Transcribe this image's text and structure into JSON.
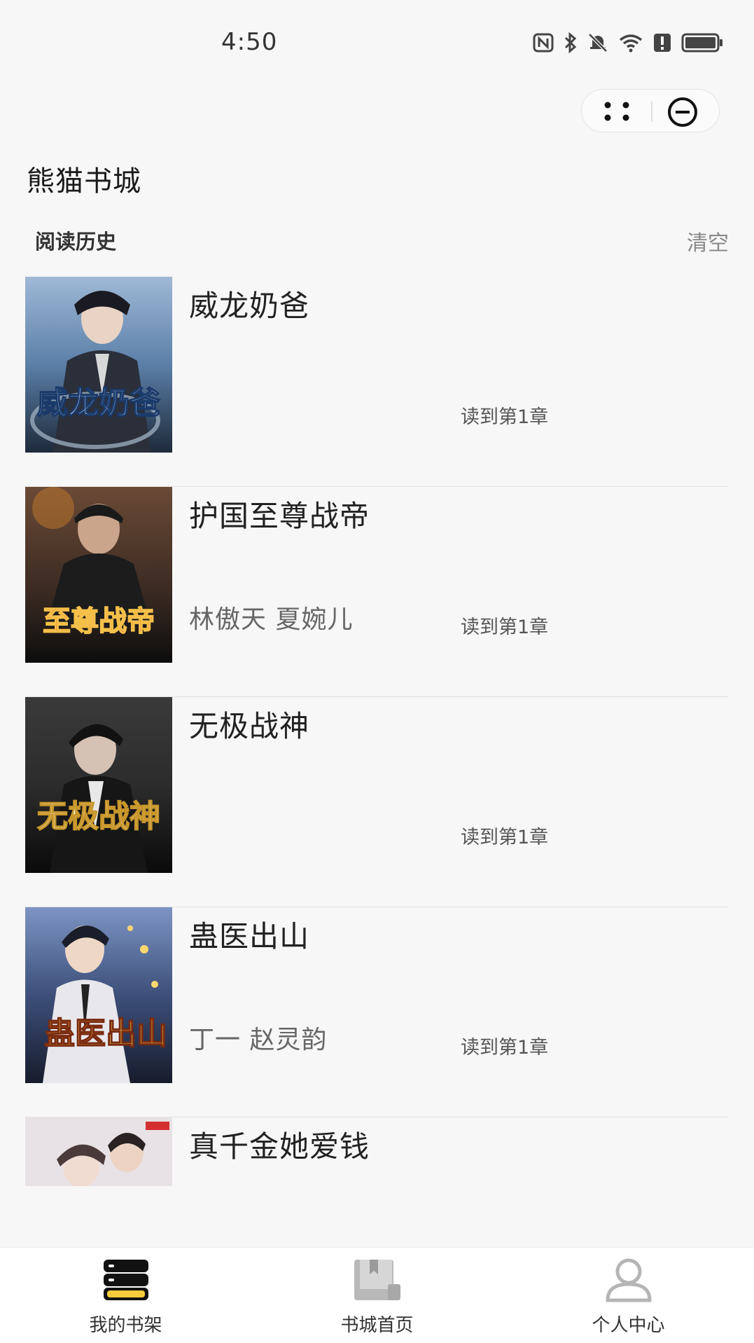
{
  "status_bar": {
    "time": "4:50",
    "icons": [
      "nfc-icon",
      "bluetooth-icon",
      "mute-icon",
      "wifi-icon",
      "alert-icon",
      "battery-icon"
    ]
  },
  "capsule": {
    "more_icon": "more-dots-icon",
    "close_icon": "minus-circle-icon"
  },
  "app_title": "熊猫书城",
  "history": {
    "title": "阅读历史",
    "clear_label": "清空"
  },
  "books": [
    {
      "title": "威龙奶爸",
      "author": "",
      "progress": "读到第1章",
      "cover_text": "威龙奶爸",
      "cover_colors": [
        "#5b7fa8",
        "#1e2a3a"
      ]
    },
    {
      "title": "护国至尊战帝",
      "author": "林傲天 夏婉儿",
      "progress": "读到第1章",
      "cover_text": "至尊战帝",
      "cover_colors": [
        "#3a2a22",
        "#0d0d0d"
      ]
    },
    {
      "title": "无极战神",
      "author": "",
      "progress": "读到第1章",
      "cover_text": "无极战神",
      "cover_colors": [
        "#2c2c2c",
        "#0a0a0a"
      ]
    },
    {
      "title": "蛊医出山",
      "author": "丁一 赵灵韵",
      "progress": "读到第1章",
      "cover_text": "蛊医出山",
      "cover_colors": [
        "#3d4f7a",
        "#171c2c"
      ]
    },
    {
      "title": "真千金她爱钱",
      "author": "",
      "progress": "",
      "cover_text": "",
      "cover_colors": [
        "#e8e2e6",
        "#c9c3c9"
      ]
    }
  ],
  "tabs": [
    {
      "label": "我的书架",
      "icon": "bookshelf-icon",
      "active": true
    },
    {
      "label": "书城首页",
      "icon": "book-store-icon",
      "active": false
    },
    {
      "label": "个人中心",
      "icon": "user-icon",
      "active": false
    }
  ],
  "colors": {
    "accent": "#f6cc3b",
    "text": "#222222",
    "muted": "#888888"
  }
}
